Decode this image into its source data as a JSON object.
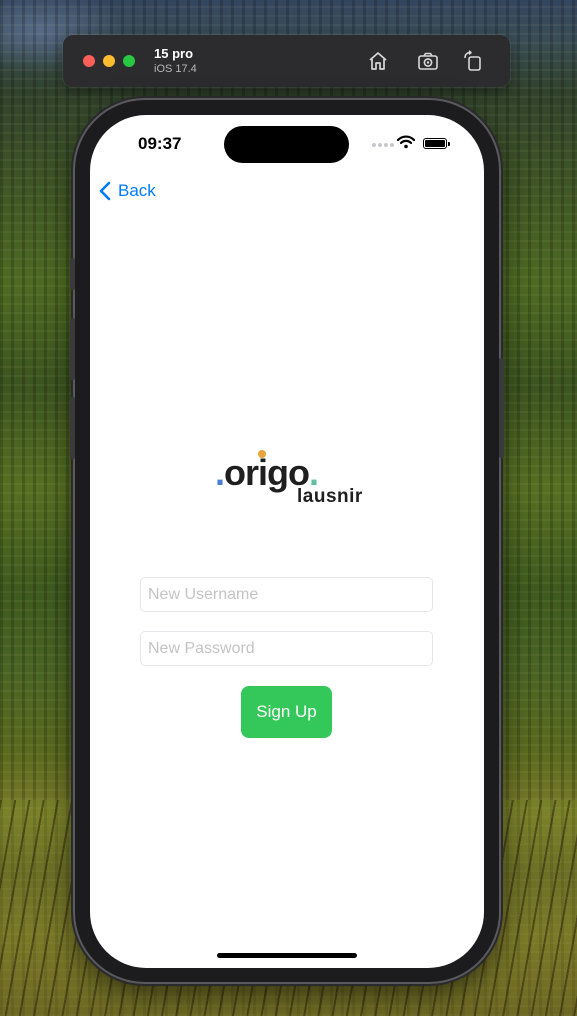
{
  "simulator": {
    "device_name": "15 pro",
    "os_version": "iOS 17.4",
    "icons": [
      "home-icon",
      "screenshot-icon",
      "rotate-icon"
    ]
  },
  "status_bar": {
    "time": "09:37"
  },
  "nav": {
    "back_label": "Back",
    "accent_color": "#007aff"
  },
  "logo": {
    "wordmark": ".origo.",
    "tagline": "lausnir",
    "dot_colors": [
      "#4a7fd4",
      "#e8a33a",
      "#5fc1a0"
    ]
  },
  "form": {
    "username_placeholder": "New Username",
    "password_placeholder": "New Password",
    "username_value": "",
    "password_value": "",
    "signup_label": "Sign Up",
    "signup_color": "#34c759"
  }
}
